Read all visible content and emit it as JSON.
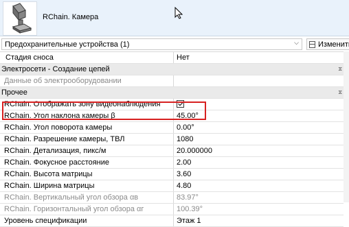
{
  "header": {
    "title": "RChain. Камера",
    "thumbnail_icon": "camera-family-thumbnail-icon"
  },
  "selector": {
    "value": "Предохранительные устройства (1)",
    "arrow_icon": "chevron-down-icon",
    "edit_type_label": "Изменить т"
  },
  "properties": {
    "top_row": {
      "name": "Стадия сноса",
      "value": "Нет"
    },
    "group_electrical": {
      "label": "Электросети - Создание цепей",
      "rows": [
        {
          "name": "Данные об электрооборудовании",
          "value": ""
        }
      ]
    },
    "group_other": {
      "label": "Прочее",
      "rows": [
        {
          "name": "RChain. Отображать зону видеонаблюдения",
          "value": "checked"
        },
        {
          "name": "RChain. Угол наклона камеры β",
          "value": "45.00°"
        },
        {
          "name": "RChain. Угол поворота камеры",
          "value": "0.00°"
        },
        {
          "name": "RChain. Разрешение камеры, ТВЛ",
          "value": "1080"
        },
        {
          "name": "RChain. Детализация, пикс/м",
          "value": "20.000000"
        },
        {
          "name": "RChain. Фокусное расстояние",
          "value": "2.00"
        },
        {
          "name": "RChain. Высота матрицы",
          "value": "3.60"
        },
        {
          "name": "RChain. Ширина матрицы",
          "value": "4.80"
        },
        {
          "name": "RChain. Вертикальный угол обзора αв",
          "value": "83.97°"
        },
        {
          "name": "RChain. Горизонтальный угол обзора αг",
          "value": "100.39°"
        },
        {
          "name": "Уровень спецификации",
          "value": "Этаж 1"
        }
      ]
    }
  },
  "colors": {
    "highlight_border": "#d72020",
    "header_bg": "#e9f2fb",
    "group_bg": "#eaeaea"
  }
}
